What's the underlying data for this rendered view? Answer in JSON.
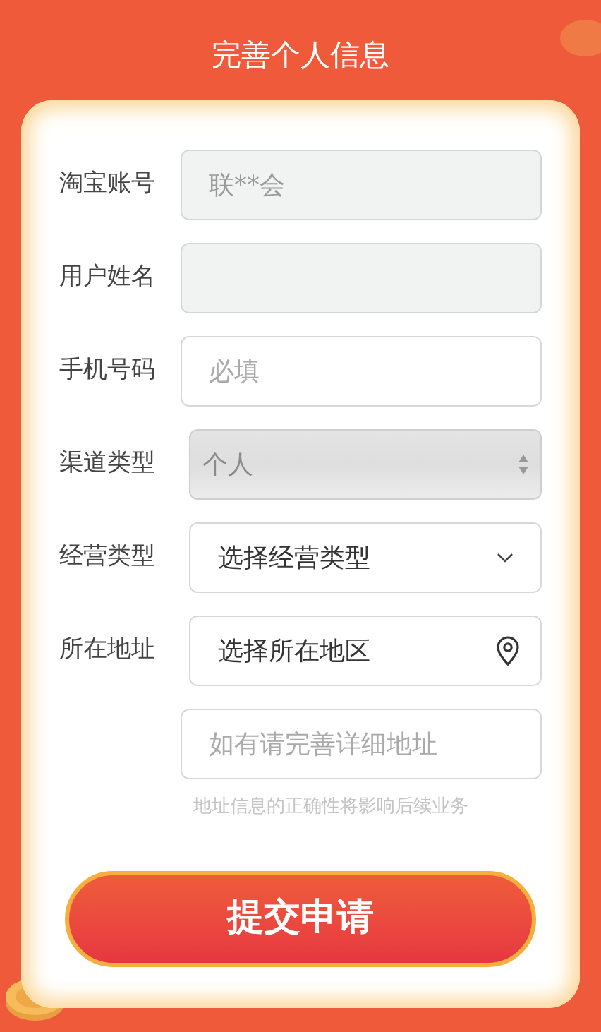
{
  "title": "完善个人信息",
  "fields": [
    {
      "kind": "input",
      "label": "淘宝账号",
      "value": "联**会",
      "disabled": true
    },
    {
      "kind": "input",
      "label": "用户姓名",
      "disabled": true
    },
    {
      "kind": "input",
      "label": "手机号码",
      "placeholder": "必填",
      "disabled": false
    },
    {
      "kind": "select",
      "label": "渠道类型",
      "value": "个人",
      "disabled": true
    },
    {
      "kind": "dropdown",
      "label": "经营类型",
      "value": "选择经营类型",
      "disabled": false
    },
    {
      "kind": "location",
      "label": "所在地址",
      "value": "选择所在地区",
      "disabled": false
    },
    {
      "kind": "input",
      "placeholder": "如有请完善详细地址",
      "disabled": false
    }
  ],
  "hint": "地址信息的正确性将影响后续业务",
  "submit": "提交申请"
}
